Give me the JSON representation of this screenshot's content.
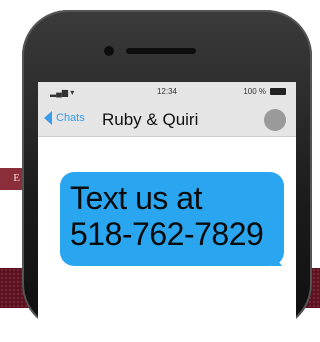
{
  "background": {
    "tab_text": "E"
  },
  "status_bar": {
    "signal": "▂▄▆ ▾",
    "time": "12:34",
    "battery_text": "100 %"
  },
  "nav": {
    "back_label": "Chats",
    "contact_name": "Ruby & Quiri"
  },
  "message": {
    "line1": "Text us at",
    "line2": "518-762-7829"
  },
  "colors": {
    "bubble": "#2aa6f0",
    "accent": "#3a9be8",
    "brand": "#5a1220"
  }
}
